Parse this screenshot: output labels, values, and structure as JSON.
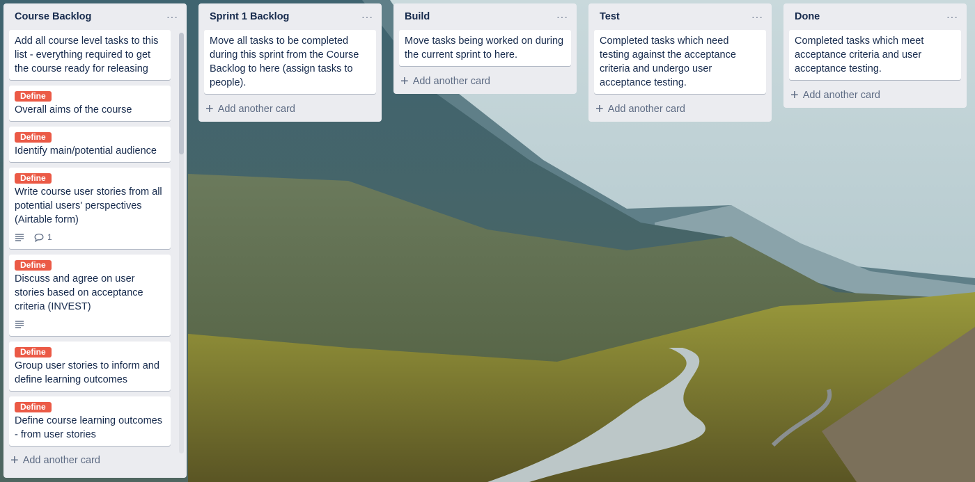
{
  "board": {
    "lists": [
      {
        "title": "Course Backlog",
        "add_label": "Add another card",
        "cards": [
          {
            "text": "Add all course level tasks to this list - everything required to get the course ready for releasing"
          },
          {
            "label": "Define",
            "text": "Overall aims of the course"
          },
          {
            "label": "Define",
            "text": "Identify main/potential audience"
          },
          {
            "label": "Define",
            "text": "Write course user stories from all potential users' perspectives (Airtable form)",
            "has_description": true,
            "comments": "1"
          },
          {
            "label": "Define",
            "text": "Discuss and agree on user stories based on acceptance criteria (INVEST)",
            "has_description": true
          },
          {
            "label": "Define",
            "text": "Group user stories to inform and define learning outcomes"
          },
          {
            "label": "Define",
            "text": "Define course learning outcomes - from user stories"
          }
        ]
      },
      {
        "title": "Sprint 1 Backlog",
        "add_label": "Add another card",
        "cards": [
          {
            "text": "Move all tasks to be completed during this sprint from the Course Backlog to here (assign tasks to people)."
          }
        ]
      },
      {
        "title": "Build",
        "add_label": "Add another card",
        "cards": [
          {
            "text": "Move tasks being worked on during the current sprint to here."
          }
        ]
      },
      {
        "title": "Test",
        "add_label": "Add another card",
        "cards": [
          {
            "text": "Completed tasks which need testing against the acceptance criteria and undergo user acceptance testing."
          }
        ]
      },
      {
        "title": "Done",
        "add_label": "Add another card",
        "cards": [
          {
            "text": "Completed tasks which meet acceptance criteria and user acceptance testing."
          }
        ]
      }
    ],
    "menu_glyph": "···",
    "plus_glyph": "+"
  },
  "colors": {
    "label_define": "#eb5a46",
    "list_bg": "#ebecf0",
    "card_bg": "#ffffff"
  }
}
